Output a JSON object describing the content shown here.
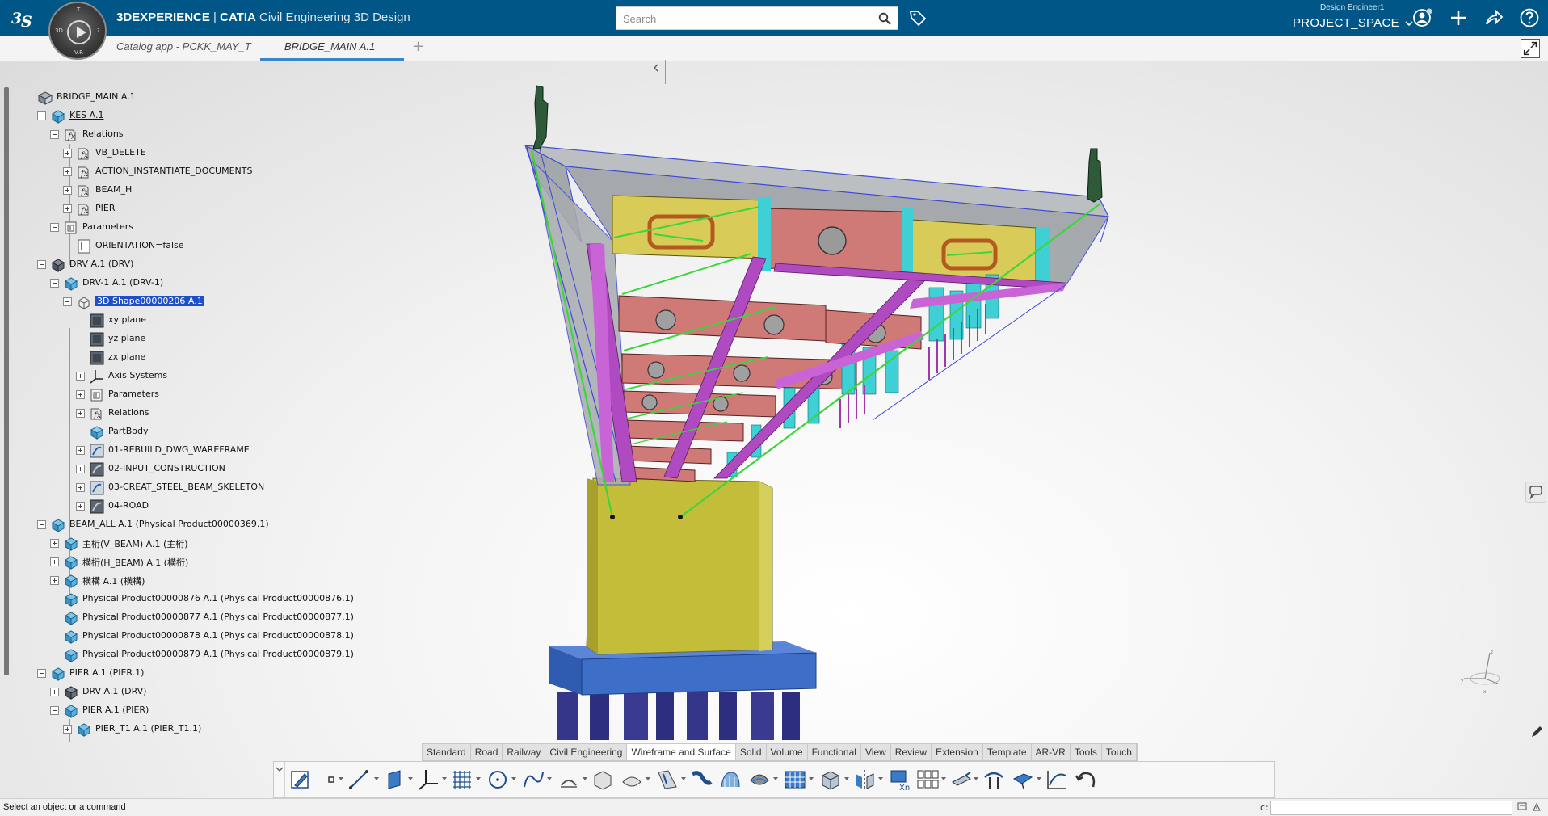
{
  "header": {
    "brand_bold": "3DEXPERIENCE",
    "brand_sep": " | ",
    "brand_catia": "CATIA",
    "app_name": "Civil Engineering 3D Design",
    "compass_top": "T",
    "compass_left": "3D",
    "compass_right": "?",
    "compass_bottom": "V.R",
    "search_placeholder": "Search",
    "user_role": "Design Engineer1",
    "project": "PROJECT_SPACE"
  },
  "tabs": [
    {
      "label": "Catalog app - PCKK_MAY_T"
    },
    {
      "label": "BRIDGE_MAIN A.1"
    }
  ],
  "tree": {
    "items": [
      {
        "label": "BRIDGE_MAIN A.1",
        "icon": "product-root-icon"
      },
      {
        "label": "KES A.1",
        "icon": "product-icon"
      },
      {
        "label": "Relations",
        "icon": "relations-icon"
      },
      {
        "label": "VB_DELETE",
        "icon": "formula-icon"
      },
      {
        "label": "ACTION_INSTANTIATE_DOCUMENTS",
        "icon": "formula-icon"
      },
      {
        "label": "BEAM_H",
        "icon": "formula-icon"
      },
      {
        "label": "PIER",
        "icon": "formula-icon"
      },
      {
        "label": "Parameters",
        "icon": "parameters-icon"
      },
      {
        "label": "ORIENTATION=false",
        "icon": "parameter-icon"
      },
      {
        "label": "DRV A.1 (DRV)",
        "icon": "product-dark-icon"
      },
      {
        "label": "DRV-1 A.1 (DRV-1)",
        "icon": "product-icon"
      },
      {
        "label": "3D Shape00000206 A.1",
        "icon": "shape-icon"
      },
      {
        "label": "xy plane",
        "icon": "plane-icon"
      },
      {
        "label": "yz plane",
        "icon": "plane-icon"
      },
      {
        "label": "zx plane",
        "icon": "plane-icon"
      },
      {
        "label": "Axis Systems",
        "icon": "axis-system-icon"
      },
      {
        "label": "Parameters",
        "icon": "parameters-icon"
      },
      {
        "label": "Relations",
        "icon": "relations-icon"
      },
      {
        "label": "PartBody",
        "icon": "partbody-icon"
      },
      {
        "label": "01-REBUILD_DWG_WAREFRAME",
        "icon": "geometrical-set-icon"
      },
      {
        "label": "02-INPUT_CONSTRUCTION",
        "icon": "geometrical-set-dark-icon"
      },
      {
        "label": "03-CREAT_STEEL_BEAM_SKELETON",
        "icon": "geometrical-set-icon"
      },
      {
        "label": "04-ROAD",
        "icon": "geometrical-set-dark-icon"
      },
      {
        "label": "BEAM_ALL A.1 (Physical Product00000369.1)",
        "icon": "product-icon"
      },
      {
        "label": "主桁(V_BEAM) A.1 (主桁)",
        "icon": "product-icon"
      },
      {
        "label": "横桁(H_BEAM) A.1 (横桁)",
        "icon": "product-icon"
      },
      {
        "label": "横構 A.1 (横構)",
        "icon": "product-icon"
      },
      {
        "label": "Physical Product00000876 A.1 (Physical Product00000876.1)",
        "icon": "product-icon"
      },
      {
        "label": "Physical Product00000877 A.1 (Physical Product00000877.1)",
        "icon": "product-icon"
      },
      {
        "label": "Physical Product00000878 A.1 (Physical Product00000878.1)",
        "icon": "product-icon"
      },
      {
        "label": "Physical Product00000879 A.1 (Physical Product00000879.1)",
        "icon": "product-icon"
      },
      {
        "label": "PIER A.1 (PIER.1)",
        "icon": "product-icon"
      },
      {
        "label": "DRV A.1 (DRV)",
        "icon": "product-dark-icon"
      },
      {
        "label": "PIER A.1 (PIER)",
        "icon": "product-icon"
      },
      {
        "label": "PIER_T1 A.1 (PIER_T1.1)",
        "icon": "product-icon"
      }
    ]
  },
  "workbench_tabs": [
    {
      "label": "Standard"
    },
    {
      "label": "Road"
    },
    {
      "label": "Railway"
    },
    {
      "label": "Civil Engineering"
    },
    {
      "label": "Wireframe and Surface"
    },
    {
      "label": "Solid"
    },
    {
      "label": "Volume"
    },
    {
      "label": "Functional"
    },
    {
      "label": "View"
    },
    {
      "label": "Review"
    },
    {
      "label": "Extension"
    },
    {
      "label": "Template"
    },
    {
      "label": "AR-VR"
    },
    {
      "label": "Tools"
    },
    {
      "label": "Touch"
    }
  ],
  "active_workbench_tab": "Wireframe and Surface",
  "status": {
    "message": "Select an object or a command",
    "command_label": "c:"
  },
  "colors": {
    "header_bg": "#005686",
    "selection": "#1e4fc8",
    "tab_underline": "#3a87c8",
    "pier_yellow": "#c4bd3a",
    "pier_cap_blue": "#3d6fc8",
    "piles_navy": "#35358a",
    "deck_grey": "#9fa4a8",
    "beam_salmon": "#d07a78",
    "beam_yellow": "#d9cb58",
    "bracing_magenta": "#b04ac0",
    "stiffener_cyan": "#3fd0d6",
    "axis_green": "#3cd63c"
  }
}
